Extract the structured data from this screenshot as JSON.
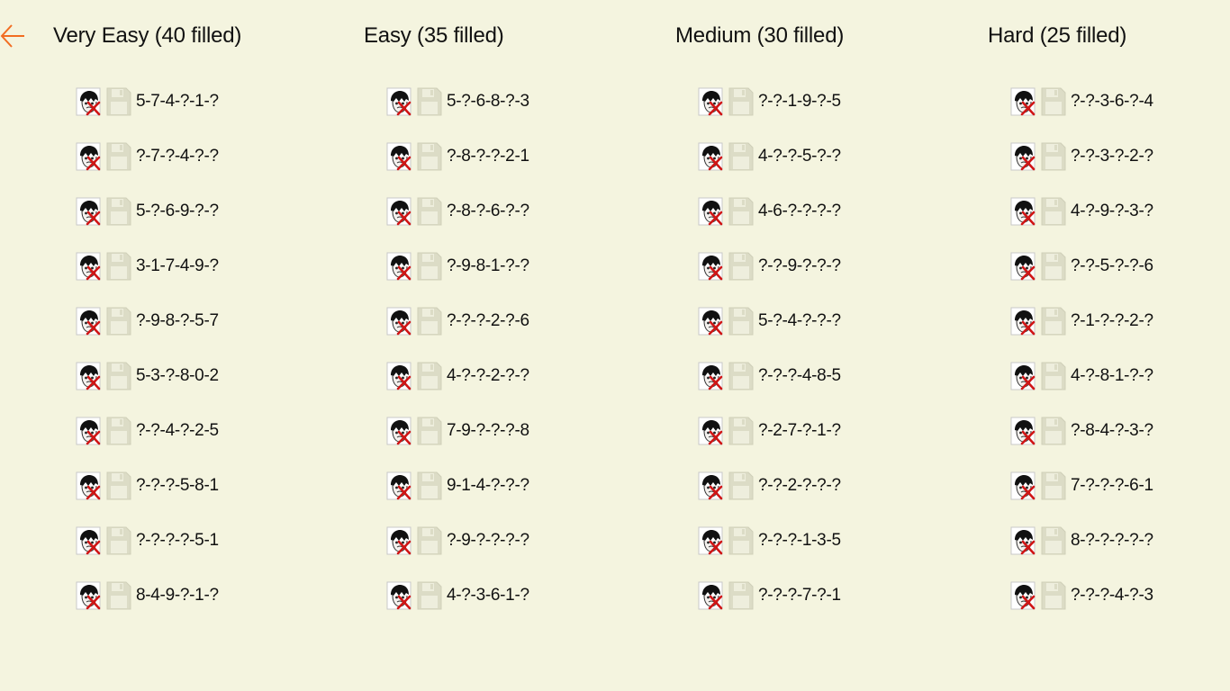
{
  "colors": {
    "background": "#f4f4df",
    "accent": "#f26d21",
    "delete_mark": "#d01515",
    "save_icon": "#dcdcc6"
  },
  "nav": {
    "back_icon": "arrow-left-icon"
  },
  "icons": {
    "delete": "face-with-red-x-icon",
    "save": "floppy-disk-icon"
  },
  "columns": [
    {
      "title": "Very Easy (40 filled)",
      "puzzles": [
        "5-7-4-?-1-?",
        "?-7-?-4-?-?",
        "5-?-6-9-?-?",
        "3-1-7-4-9-?",
        "?-9-8-?-5-7",
        "5-3-?-8-0-2",
        "?-?-4-?-2-5",
        "?-?-?-5-8-1",
        "?-?-?-?-5-1",
        "8-4-9-?-1-?"
      ]
    },
    {
      "title": "Easy (35 filled)",
      "puzzles": [
        "5-?-6-8-?-3",
        "?-8-?-?-2-1",
        "?-8-?-6-?-?",
        "?-9-8-1-?-?",
        "?-?-?-2-?-6",
        "4-?-?-2-?-?",
        "7-9-?-?-?-8",
        "9-1-4-?-?-?",
        "?-9-?-?-?-?",
        "4-?-3-6-1-?"
      ]
    },
    {
      "title": "Medium (30 filled)",
      "puzzles": [
        "?-?-1-9-?-5",
        "4-?-?-5-?-?",
        "4-6-?-?-?-?",
        "?-?-9-?-?-?",
        "5-?-4-?-?-?",
        "?-?-?-4-8-5",
        "?-2-7-?-1-?",
        "?-?-2-?-?-?",
        "?-?-?-1-3-5",
        "?-?-?-7-?-1"
      ]
    },
    {
      "title": "Hard (25 filled)",
      "puzzles": [
        "?-?-3-6-?-4",
        "?-?-3-?-2-?",
        "4-?-9-?-3-?",
        "?-?-5-?-?-6",
        "?-1-?-?-2-?",
        "4-?-8-1-?-?",
        "?-8-4-?-3-?",
        "7-?-?-?-6-1",
        "8-?-?-?-?-?",
        "?-?-?-4-?-3"
      ]
    }
  ]
}
